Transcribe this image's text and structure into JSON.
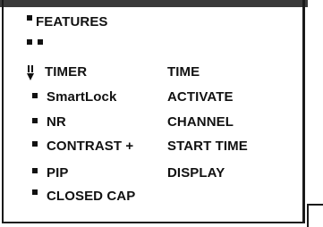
{
  "menu": {
    "title": "FEATURES",
    "left_items": [
      "TIMER",
      "SmartLock",
      "NR",
      "CONTRAST +",
      "PIP",
      "CLOSED CAP"
    ],
    "right_items": [
      "TIME",
      "ACTIVATE",
      "CHANNEL",
      "START TIME",
      "DISPLAY"
    ],
    "selected_item": "TIMER",
    "cursor_icon": "down-arrow-cursor-icon"
  }
}
